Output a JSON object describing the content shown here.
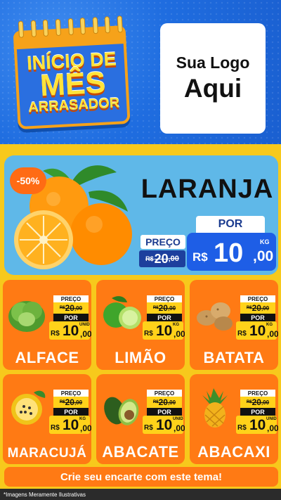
{
  "header": {
    "campaign_line1": "INÍCIO DE",
    "campaign_line2": "MÊS",
    "campaign_line3": "ARRASADOR",
    "logo_line1": "Sua Logo",
    "logo_line2": "Aqui"
  },
  "hero": {
    "discount": "-50%",
    "product": "LARANJA",
    "old_label": "PREÇO",
    "old_currency": "R$",
    "old_int": "20",
    "old_cents": ",00",
    "new_label": "POR",
    "new_currency": "R$",
    "new_int": "10",
    "new_cents": ",00",
    "unit": "KG"
  },
  "products": [
    {
      "name": "ALFACE",
      "old_label": "PREÇO",
      "old_currency": "R$",
      "old_int": "20",
      "old_cents": ",00",
      "new_label": "POR",
      "new_currency": "R$",
      "new_int": "10",
      "new_cents": ",00",
      "unit": "UNID",
      "icon": "lettuce-icon"
    },
    {
      "name": "LIMÃO",
      "old_label": "PREÇO",
      "old_currency": "R$",
      "old_int": "20",
      "old_cents": ",00",
      "new_label": "POR",
      "new_currency": "R$",
      "new_int": "10",
      "new_cents": ",00",
      "unit": "KG",
      "icon": "lime-icon"
    },
    {
      "name": "BATATA",
      "old_label": "PREÇO",
      "old_currency": "R$",
      "old_int": "20",
      "old_cents": ",00",
      "new_label": "POR",
      "new_currency": "R$",
      "new_int": "10",
      "new_cents": ",00",
      "unit": "KG",
      "icon": "potato-icon"
    },
    {
      "name": "MARACUJÁ",
      "old_label": "PREÇO",
      "old_currency": "R$",
      "old_int": "20",
      "old_cents": ",00",
      "new_label": "POR",
      "new_currency": "R$",
      "new_int": "10",
      "new_cents": ",00",
      "unit": "KG",
      "icon": "passion-fruit-icon"
    },
    {
      "name": "ABACATE",
      "old_label": "PREÇO",
      "old_currency": "R$",
      "old_int": "20",
      "old_cents": ",00",
      "new_label": "POR",
      "new_currency": "R$",
      "new_int": "10",
      "new_cents": ",00",
      "unit": "UNID",
      "icon": "avocado-icon"
    },
    {
      "name": "ABACAXI",
      "old_label": "PREÇO",
      "old_currency": "R$",
      "old_int": "20",
      "old_cents": ",00",
      "new_label": "POR",
      "new_currency": "R$",
      "new_int": "10",
      "new_cents": ",00",
      "unit": "UNID",
      "icon": "pineapple-icon"
    }
  ],
  "cta": "Crie seu encarte com este tema!",
  "footer_note": "*Imagens Meramente Ilustrativas",
  "colors": {
    "header_blue": "#1f6de0",
    "background_yellow": "#f7c91c",
    "card_orange": "#ff7a14",
    "hero_sky": "#5fb8e8",
    "price_blue": "#1e5ee6"
  }
}
